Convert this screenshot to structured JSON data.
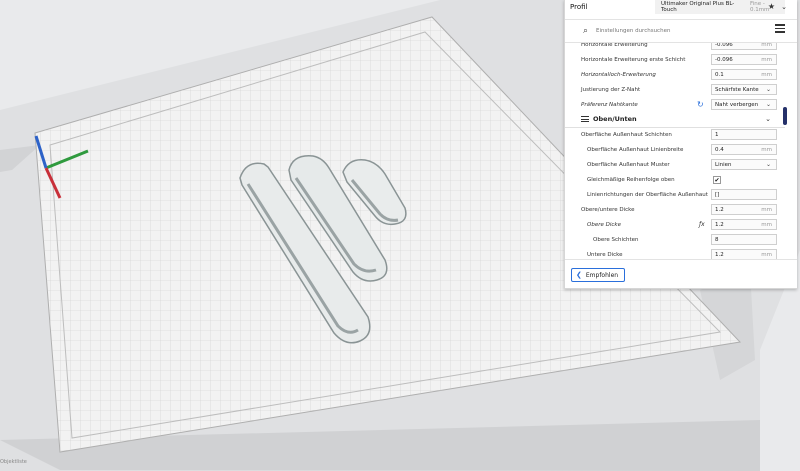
{
  "panel": {
    "profile_label": "Profil",
    "printer": "Ultimaker Original Plus BL-Touch",
    "printer_sub": "Fine - 0.1mm",
    "search_placeholder": "Einstellungen durchsuchen",
    "icons": {
      "star": "star-icon",
      "chevron": "chevron-down-icon",
      "menu": "menu-icon",
      "search": "search-icon",
      "reset": "reset-icon",
      "fx": "function-icon"
    },
    "settings_before": [
      {
        "name": "Horizontale Erweiterung",
        "value": "-0.096",
        "unit": "mm"
      },
      {
        "name": "Horizontale Erweiterung erste Schicht",
        "value": "-0.096",
        "unit": "mm"
      },
      {
        "name": "Horizontalloch-Erweiterung",
        "value": "0.1",
        "unit": "mm",
        "italic": true
      },
      {
        "name": "Justierung der Z-Naht",
        "value": "Schärfste Kante",
        "dropdown": true
      },
      {
        "name": "Präferenz Nahtkante",
        "value": "Naht verbergen",
        "dropdown": true,
        "italic": true
      }
    ],
    "category": "Oben/Unten",
    "settings_after": [
      {
        "name": "Oberfläche Außenhaut Schichten",
        "value": "1",
        "indent": 0
      },
      {
        "name": "Oberfläche Außenhaut Linienbreite",
        "value": "0.4",
        "unit": "mm",
        "indent": 1
      },
      {
        "name": "Oberfläche Außenhaut Muster",
        "value": "Linien",
        "dropdown": true,
        "indent": 1
      },
      {
        "name": "Gleichmäßige Reihenfolge oben",
        "checkbox": true,
        "value": "✔",
        "indent": 1
      },
      {
        "name": "Linienrichtungen der Oberfläche Außenhaut",
        "value": "[]",
        "indent": 1
      },
      {
        "name": "Obere/untere Dicke",
        "value": "1.2",
        "unit": "mm",
        "indent": 0
      },
      {
        "name": "Obere Dicke",
        "value": "1.2",
        "unit": "mm",
        "indent": 1,
        "italic": true
      },
      {
        "name": "Obere Schichten",
        "value": "8",
        "indent": 2
      },
      {
        "name": "Untere Dicke",
        "value": "1.2",
        "unit": "mm",
        "indent": 1
      }
    ],
    "recommended_button": "Empfohlen"
  },
  "status": {
    "object_list": "Objektliste"
  },
  "colors": {
    "accent": "#2a6fdb",
    "scroll": "#25316a",
    "plate": "#f2f2f2"
  }
}
